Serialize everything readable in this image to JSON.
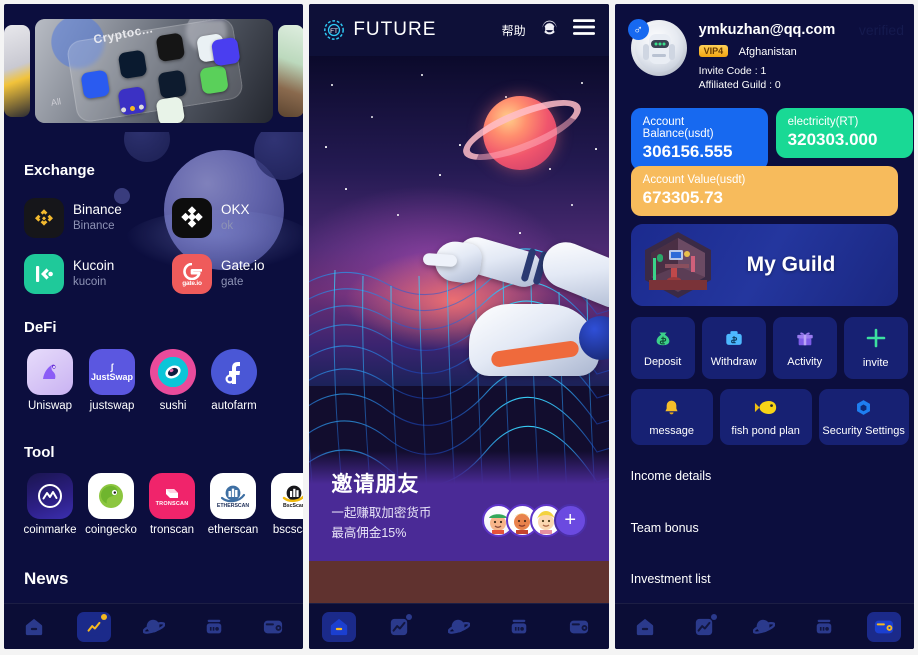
{
  "panel_home": {
    "banner": {
      "name": "crypto-apps-photo",
      "caption": "Cryptoc...",
      "all_label": "All"
    },
    "sections": [
      {
        "title": "Exchange"
      },
      {
        "title": "DeFi"
      },
      {
        "title": "Tool"
      },
      {
        "title": "News"
      }
    ],
    "exchanges": [
      {
        "name": "Binance",
        "sub": "Binance",
        "icon": "binance-icon",
        "bg": "#16161a",
        "fg": "#f3ba2f"
      },
      {
        "name": "OKX",
        "sub": "ok",
        "icon": "okx-icon",
        "bg": "#0d0d0d",
        "fg": "#ffffff"
      },
      {
        "name": "Kucoin",
        "sub": "kucoin",
        "icon": "kucoin-icon",
        "bg": "#1fc99a",
        "fg": "#ffffff"
      },
      {
        "name": "Gate.io",
        "sub": "gate",
        "icon": "gateio-icon",
        "bg": "#ef5b5b",
        "fg": "#ffffff"
      }
    ],
    "defi": [
      {
        "label": "Uniswap",
        "icon": "uniswap-icon",
        "bg": "#ddcdf7",
        "fg": "#7b4fd0"
      },
      {
        "label": "justswap",
        "icon": "justswap-icon",
        "bg": "#5b57e0",
        "fg": "#ffffff"
      },
      {
        "label": "sushi",
        "icon": "sushi-icon",
        "bg": "#ffffff",
        "fg": "#e94b9b"
      },
      {
        "label": "autofarm",
        "icon": "autofarm-icon",
        "bg": "#4a57d6",
        "fg": "#ffffff"
      }
    ],
    "tool": [
      {
        "label": "coinmarke",
        "icon": "coinmarketcap-icon",
        "bg": "#16124a",
        "fg": "#ffffff"
      },
      {
        "label": "coingecko",
        "icon": "coingecko-icon",
        "bg": "#ffffff",
        "fg": "#8cc63f"
      },
      {
        "label": "tronscan",
        "icon": "tronscan-icon",
        "bg": "#f0246b",
        "fg": "#ffffff"
      },
      {
        "label": "etherscan",
        "icon": "etherscan-icon",
        "bg": "#ffffff",
        "fg": "#21325b"
      },
      {
        "label": "bscscan",
        "icon": "bscscan-icon",
        "bg": "#ffffff",
        "fg": "#16161a"
      }
    ]
  },
  "panel_future": {
    "header": {
      "brand": "FUTURE",
      "help": "帮助",
      "logo": "future-logo-icon",
      "support": "support-headset-icon",
      "menu": "hamburger-menu-icon"
    },
    "hero": {
      "planet": "saturn-planet",
      "astronaut": "astronaut-illustration",
      "grid": "wireframe-terrain"
    },
    "invite": {
      "title": "邀请朋友",
      "line1": "一起赚取加密货币",
      "line2": "最高佣金15%",
      "plus": "+",
      "avatars": [
        "🧑",
        "🧒",
        "👦"
      ]
    }
  },
  "panel_mine": {
    "profile": {
      "email": "ymkuzhan@qq.com",
      "vip": "VIP4",
      "country": "Afghanistan",
      "invite_code": "Invite Code : 1",
      "affiliated_guild": "Affiliated Guild : 0",
      "verified": "verified",
      "gender_icon": "male-gender-icon",
      "avatar": "robot-avatar"
    },
    "stats": [
      {
        "label": "Account Balance(usdt)",
        "value": "306156.555",
        "color": "#1769f0"
      },
      {
        "label": "electricity(RT)",
        "value": "320303.000",
        "color": "#19d995"
      },
      {
        "label": "Account Value(usdt)",
        "value": "673305.73",
        "color": "#f7bb5c"
      }
    ],
    "guild": {
      "label": "My Guild",
      "art": "isometric-room-icon"
    },
    "quick_actions": [
      {
        "label": "Deposit",
        "icon": "money-bag-icon",
        "glyph": "💰"
      },
      {
        "label": "Withdraw",
        "icon": "briefcase-dollar-icon",
        "glyph": "💼"
      },
      {
        "label": "Activity",
        "icon": "gift-icon",
        "glyph": "🎁"
      },
      {
        "label": "invite",
        "icon": "plus-icon",
        "glyph": "+"
      },
      {
        "label": "message",
        "icon": "bell-icon",
        "glyph": "🔔"
      },
      {
        "label": "fish pond plan",
        "icon": "fish-icon",
        "glyph": "🐟"
      },
      {
        "label": "Security Settings",
        "icon": "shield-hex-icon",
        "glyph": "⬢"
      }
    ],
    "menu": [
      {
        "label": "Income details"
      },
      {
        "label": "Team bonus"
      },
      {
        "label": "Investment list"
      }
    ]
  },
  "navbar": {
    "items": [
      {
        "name": "nav-home",
        "icon": "home-icon"
      },
      {
        "name": "nav-market",
        "icon": "chart-trend-icon"
      },
      {
        "name": "nav-planet",
        "icon": "planet-icon"
      },
      {
        "name": "nav-mining",
        "icon": "mining-machine-icon"
      },
      {
        "name": "nav-wallet",
        "icon": "wallet-icon"
      }
    ],
    "active_home_panel": 1,
    "active_future_panel": 0,
    "active_mine_panel": 4
  },
  "colors": {
    "bg_dark": "#0c0e3e",
    "nav_bg": "#0b0d36",
    "accent_blue": "#1769f0",
    "accent_green": "#19d995",
    "accent_orange": "#f7bb5c",
    "card": "#172173"
  }
}
